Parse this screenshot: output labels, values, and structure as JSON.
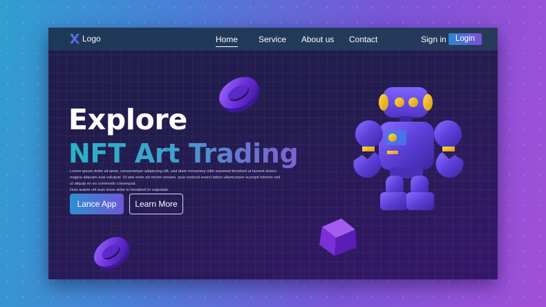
{
  "nav": {
    "logo_text": "Logo",
    "links": [
      "Home",
      "Service",
      "About us",
      "Contact"
    ],
    "signin_label": "Sign in",
    "login_label": "Login"
  },
  "hero": {
    "title_line1": "Explore",
    "title_line2": "NFT Art Trading",
    "body_lines": [
      "Lorem ipsum dolor sit amet, consectetuer adipiscing elit, sed diam nonummy nibh euismod tincidunt ut laoreet dolore",
      "magna aliquam erat volutpat. Ut wisi enim ad minim veniam, quis nostrud exerci tation ullamcorper suscipit lobortis nisl ut aliquip ex ea commodo consequat.",
      "Duis autem vel eum iriure dolor in hendrerit in vulputate."
    ],
    "primary_button": "Lance App",
    "secondary_button": "Learn More"
  },
  "colors": {
    "accent_cyan": "#27b3c8",
    "accent_purple": "#7e62d3",
    "robot_purple": "#5b3fd8",
    "robot_gold": "#f2c21c"
  }
}
